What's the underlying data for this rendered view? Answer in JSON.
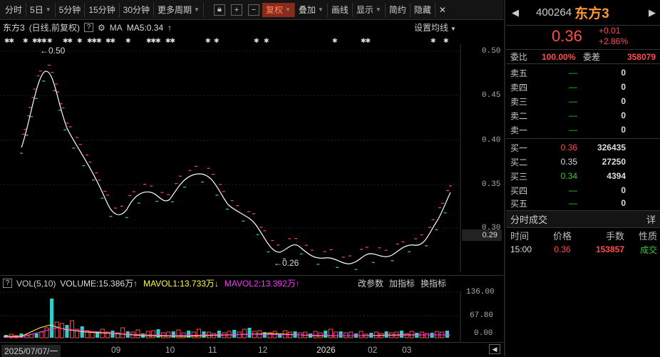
{
  "toolbar": {
    "items": [
      "分时",
      "5日",
      "5分钟",
      "15分钟",
      "30分钟",
      "更多周期"
    ],
    "tools": [
      "叠加",
      "画线",
      "显示",
      "简约",
      "隐藏"
    ],
    "adjust": "复权",
    "close": "✕"
  },
  "chart_info": {
    "name": "东方3",
    "mode": "(日线,前复权)",
    "ma_label": "MA",
    "ma5": "MA5:0.34",
    "set_ma": "设置均线"
  },
  "price_axis": [
    "0.50",
    "0.45",
    "0.40",
    "0.35",
    "0.30"
  ],
  "current_price_tag": "0.29",
  "annotations": {
    "high": "←0.50",
    "low": "←0.26"
  },
  "volume_header": {
    "vol": "VOL(5,10)",
    "volume": "VOLUME:15.386万",
    "mavol1": "MAVOL1:13.733万",
    "mavol2": "MAVOL2:13.392万",
    "btn1": "改参数",
    "btn2": "加指标",
    "btn3": "换指标"
  },
  "volume_axis": [
    "136.00",
    "67.80",
    "0.00"
  ],
  "x_axis": [
    "2025/07/07/一",
    "09",
    "10",
    "11",
    "12",
    "2026",
    "02",
    "03"
  ],
  "right_panel": {
    "code": "400264",
    "name": "东方3",
    "price": "0.36",
    "change": "+0.01",
    "change_pct": "+2.86%",
    "weibi_label": "委比",
    "weibi": "100.00%",
    "weicha_label": "委差",
    "weicha": "358079",
    "asks": [
      {
        "label": "卖五",
        "price": "—",
        "vol": "0"
      },
      {
        "label": "卖四",
        "price": "—",
        "vol": "0"
      },
      {
        "label": "卖三",
        "price": "—",
        "vol": "0"
      },
      {
        "label": "卖二",
        "price": "—",
        "vol": "0"
      },
      {
        "label": "卖一",
        "price": "—",
        "vol": "0"
      }
    ],
    "bids": [
      {
        "label": "买一",
        "price": "0.36",
        "vol": "326435"
      },
      {
        "label": "买二",
        "price": "0.35",
        "vol": "27250"
      },
      {
        "label": "买三",
        "price": "0.34",
        "vol": "4394"
      },
      {
        "label": "买四",
        "price": "—",
        "vol": "0"
      },
      {
        "label": "买五",
        "price": "—",
        "vol": "0"
      }
    ],
    "ticks_title": "分时成交",
    "ticks_btn": "详",
    "tick_headers": [
      "时间",
      "价格",
      "手数",
      "性质"
    ],
    "ticks": [
      {
        "time": "15:00",
        "price": "0.36",
        "vol": "153857",
        "type": "成交"
      }
    ]
  },
  "colors": {
    "up": "#ff4d4d",
    "down": "#33cccc",
    "ma5": "#ffffff",
    "accent": "#ff9933"
  }
}
